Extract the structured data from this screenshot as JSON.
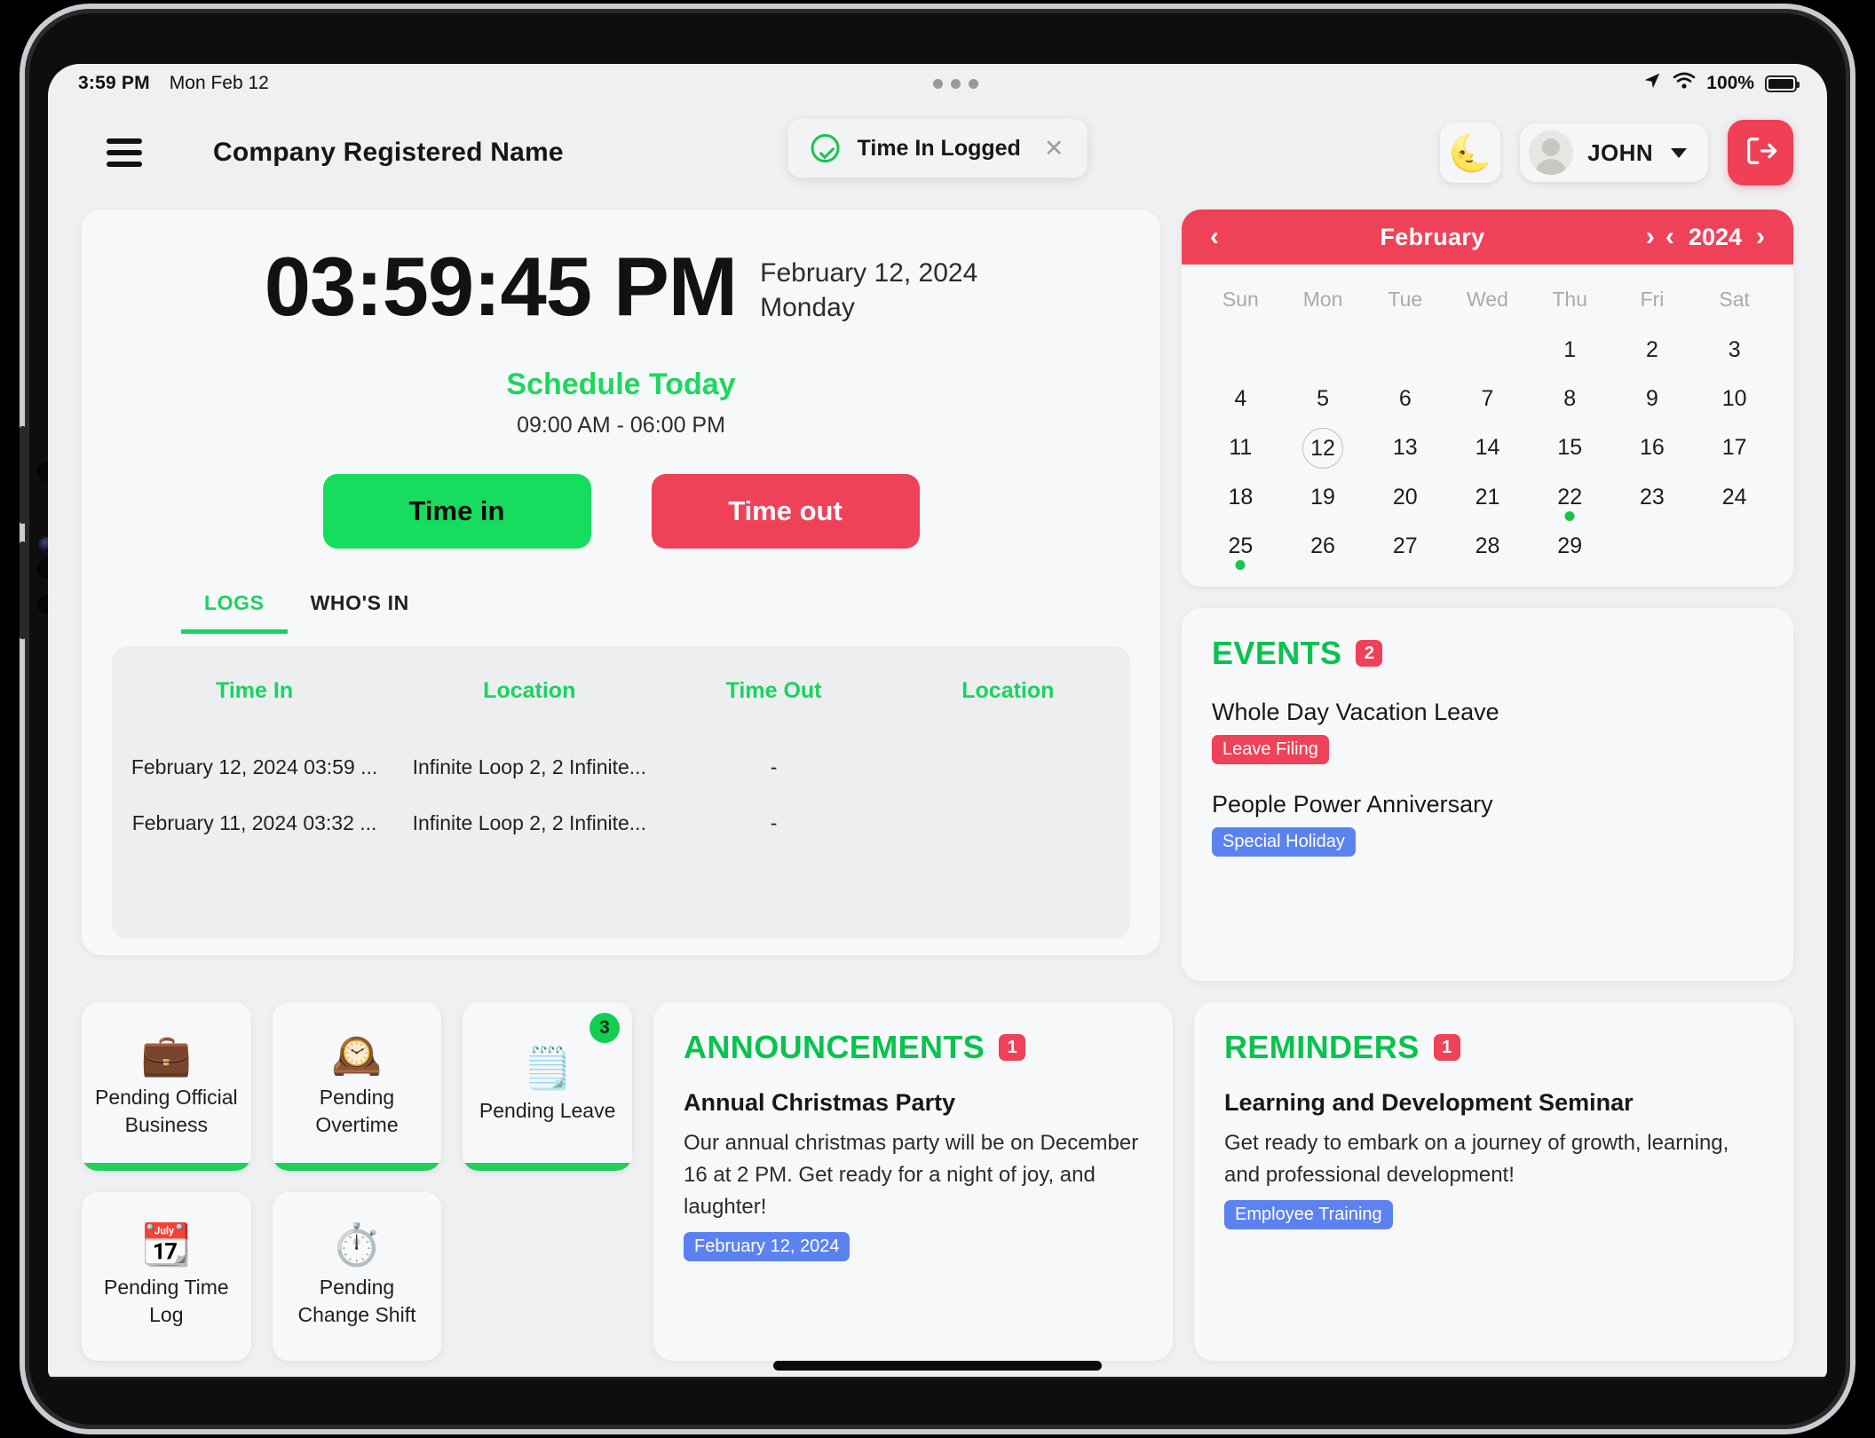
{
  "status_bar": {
    "time": "3:59 PM",
    "date": "Mon Feb 12",
    "battery_percent": "100%",
    "location_icon": "location-arrow-icon",
    "wifi_icon": "wifi-icon",
    "battery_icon": "battery-full-icon"
  },
  "header": {
    "menu_icon": "hamburger-menu-icon",
    "company_name": "Company Registered Name",
    "toast": {
      "icon": "check-circle-icon",
      "message": "Time In Logged",
      "close_icon": "close-icon"
    },
    "theme_toggle_icon": "🌜",
    "user_name": "JOHN",
    "avatar_icon": "user-avatar-icon",
    "chevron_icon": "chevron-down-icon",
    "logout_icon": "logout-icon"
  },
  "clock": {
    "time": "03:59:45 PM",
    "date": "February 12, 2024",
    "day": "Monday",
    "schedule_title": "Schedule Today",
    "schedule_time": "09:00 AM - 06:00 PM",
    "time_in_label": "Time in",
    "time_out_label": "Time out",
    "time_in_color": "#16dd5e",
    "time_out_color": "#ef4158"
  },
  "log_tabs": [
    {
      "label": "LOGS",
      "active": true
    },
    {
      "label": "WHO'S IN",
      "active": false
    }
  ],
  "log_table": {
    "columns": [
      "Time In",
      "Location",
      "Time Out",
      "Location"
    ],
    "rows": [
      [
        "February 12, 2024 03:59 ...",
        "Infinite Loop 2, 2 Infinite...",
        "-",
        ""
      ],
      [
        "February 11, 2024 03:32 ...",
        "Infinite Loop 2, 2 Infinite...",
        "-",
        ""
      ]
    ]
  },
  "calendar": {
    "prev_month_icon": "chevron-left-icon",
    "next_month_icon": "chevron-right-icon",
    "prev_year_icon": "chevron-left-icon",
    "next_year_icon": "chevron-right-icon",
    "month": "February",
    "year": "2024",
    "day_names": [
      "Sun",
      "Mon",
      "Tue",
      "Wed",
      "Thu",
      "Fri",
      "Sat"
    ],
    "weeks": [
      [
        "",
        "",
        "",
        "",
        "1",
        "2",
        "3"
      ],
      [
        "4",
        "5",
        "6",
        "7",
        "8",
        "9",
        "10"
      ],
      [
        "11",
        "12",
        "13",
        "14",
        "15",
        "16",
        "17"
      ],
      [
        "18",
        "19",
        "20",
        "21",
        "22",
        "23",
        "24"
      ],
      [
        "25",
        "26",
        "27",
        "28",
        "29",
        "",
        ""
      ]
    ],
    "today": "12",
    "marked_days": [
      "22",
      "25"
    ],
    "header_color": "#ef4158",
    "marker_color": "#17c64a"
  },
  "events": {
    "title": "EVENTS",
    "count": "2",
    "items": [
      {
        "name": "Whole Day Vacation Leave",
        "tag": "Leave Filing",
        "tag_color": "#ef4158"
      },
      {
        "name": "People Power Anniversary",
        "tag": "Special Holiday",
        "tag_color": "#5b82ef"
      }
    ]
  },
  "pending_cards": [
    {
      "icon": "💼",
      "icon_name": "briefcase-icon",
      "label": "Pending Official Business",
      "badge": "",
      "bar": true
    },
    {
      "icon": "🕰️",
      "icon_name": "clock-icon",
      "label": "Pending Overtime",
      "badge": "",
      "bar": true
    },
    {
      "icon": "🗒️",
      "icon_name": "leave-notepad-icon",
      "label": "Pending Leave",
      "badge": "3",
      "bar": true
    },
    {
      "icon": "📆",
      "icon_name": "calendar-clock-icon",
      "label": "Pending Time Log",
      "badge": "",
      "bar": false
    },
    {
      "icon": "⏱️",
      "icon_name": "stopwatch-icon",
      "label": "Pending Change Shift",
      "badge": "",
      "bar": false
    }
  ],
  "announcements": {
    "title": "ANNOUNCEMENTS",
    "count": "1",
    "items": [
      {
        "title": "Annual Christmas Party",
        "body": "Our annual christmas party will be on December 16 at 2 PM. Get ready for a night of joy, and laughter!",
        "tag": "February 12, 2024",
        "tag_color": "#5b82ef"
      }
    ]
  },
  "reminders": {
    "title": "REMINDERS",
    "count": "1",
    "items": [
      {
        "title": "Learning and Development Seminar",
        "body": "Get ready to embark on a journey of growth, learning, and professional development!",
        "tag": "Employee Training",
        "tag_color": "#5b82ef"
      }
    ]
  }
}
